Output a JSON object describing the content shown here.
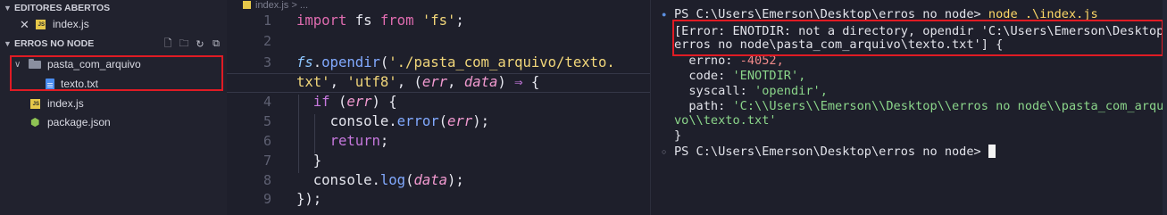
{
  "sidebar": {
    "open_editors_header": "EDITORES ABERTOS",
    "open_editor_file": "index.js",
    "project_header": "ERROS NO NODE",
    "tree": [
      {
        "label": "pasta_com_arquivo",
        "kind": "folder"
      },
      {
        "label": "texto.txt",
        "kind": "txt"
      },
      {
        "label": "index.js",
        "kind": "js"
      },
      {
        "label": "package.json",
        "kind": "pkg"
      }
    ],
    "header_actions": [
      "new-file-icon",
      "new-folder-icon",
      "refresh-icon",
      "collapse-icon"
    ]
  },
  "editor": {
    "breadcrumb_file": "index.js",
    "breadcrumb_sep": " > ...",
    "line_numbers": [
      "1",
      "2",
      "3",
      "",
      "4",
      "5",
      "6",
      "7",
      "8",
      "9"
    ],
    "code_plain": [
      "import fs from 'fs';",
      "",
      "fs.opendir('./pasta_com_arquivo/texto.",
      "txt', 'utf8', (err, data) ⇒ {",
      "  if (err) {",
      "    console.error(err);",
      "    return;",
      "  }",
      "  console.log(data);",
      "});"
    ]
  },
  "terminal": {
    "prompt_line_1": "PS C:\\Users\\Emerson\\Desktop\\erros no node> ",
    "command_1": "node .\\index.js",
    "error_line_1": "[Error: ENOTDIR: not a directory, opendir 'C:\\Users\\Emerson\\Desktop\\",
    "error_line_2": "erros no node\\pasta_com_arquivo\\texto.txt'] {",
    "errno_key": "  errno: ",
    "errno_val": "-4052,",
    "code_key": "  code: ",
    "code_val": "'ENOTDIR',",
    "syscall_key": "  syscall: ",
    "syscall_val": "'opendir',",
    "path_key": "  path: ",
    "path_val_1": "'C:\\\\Users\\\\Emerson\\\\Desktop\\\\erros no node\\\\pasta_com_arqui",
    "path_val_2": "vo\\\\texto.txt'",
    "close_brace": "}",
    "prompt_line_2": "PS C:\\Users\\Emerson\\Desktop\\erros no node> "
  },
  "colors": {
    "highlight_box": "#e01b24",
    "background": "#1e1f2b",
    "sidebar_bg": "#21222e"
  }
}
